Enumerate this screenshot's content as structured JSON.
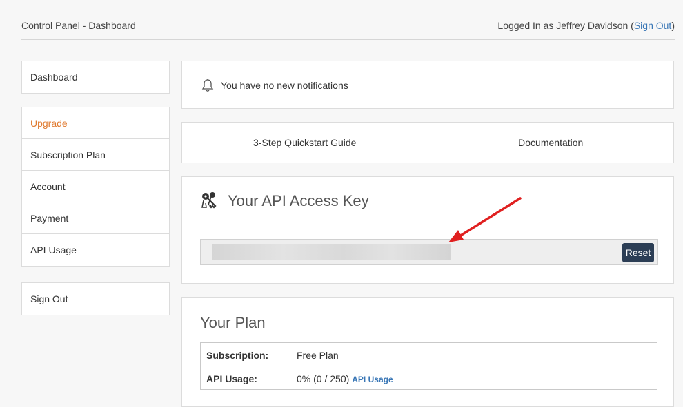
{
  "header": {
    "title": "Control Panel - Dashboard",
    "login_prefix": "Logged In as Jeffrey Davidson (",
    "signout_label": "Sign Out",
    "login_suffix": ")"
  },
  "sidebar": {
    "dashboard": "Dashboard",
    "items": [
      {
        "label": "Upgrade"
      },
      {
        "label": "Subscription Plan"
      },
      {
        "label": "Account"
      },
      {
        "label": "Payment"
      },
      {
        "label": "API Usage"
      }
    ],
    "signout": "Sign Out"
  },
  "notifications": {
    "text": "You have no new notifications",
    "icon": "bell-icon"
  },
  "links": {
    "quickstart": "3-Step Quickstart Guide",
    "documentation": "Documentation"
  },
  "api_key": {
    "title": "Your API Access Key",
    "reset_label": "Reset",
    "icon": "key-icon"
  },
  "plan": {
    "title": "Your Plan",
    "subscription_label": "Subscription:",
    "subscription_value": "Free Plan",
    "usage_label": "API Usage:",
    "usage_value": "0% (0 / 250)",
    "usage_link": "API Usage"
  },
  "colors": {
    "accent_link": "#3a77b6",
    "upgrade": "#e07a2f",
    "button": "#2c3e55",
    "arrow": "#e02020"
  }
}
